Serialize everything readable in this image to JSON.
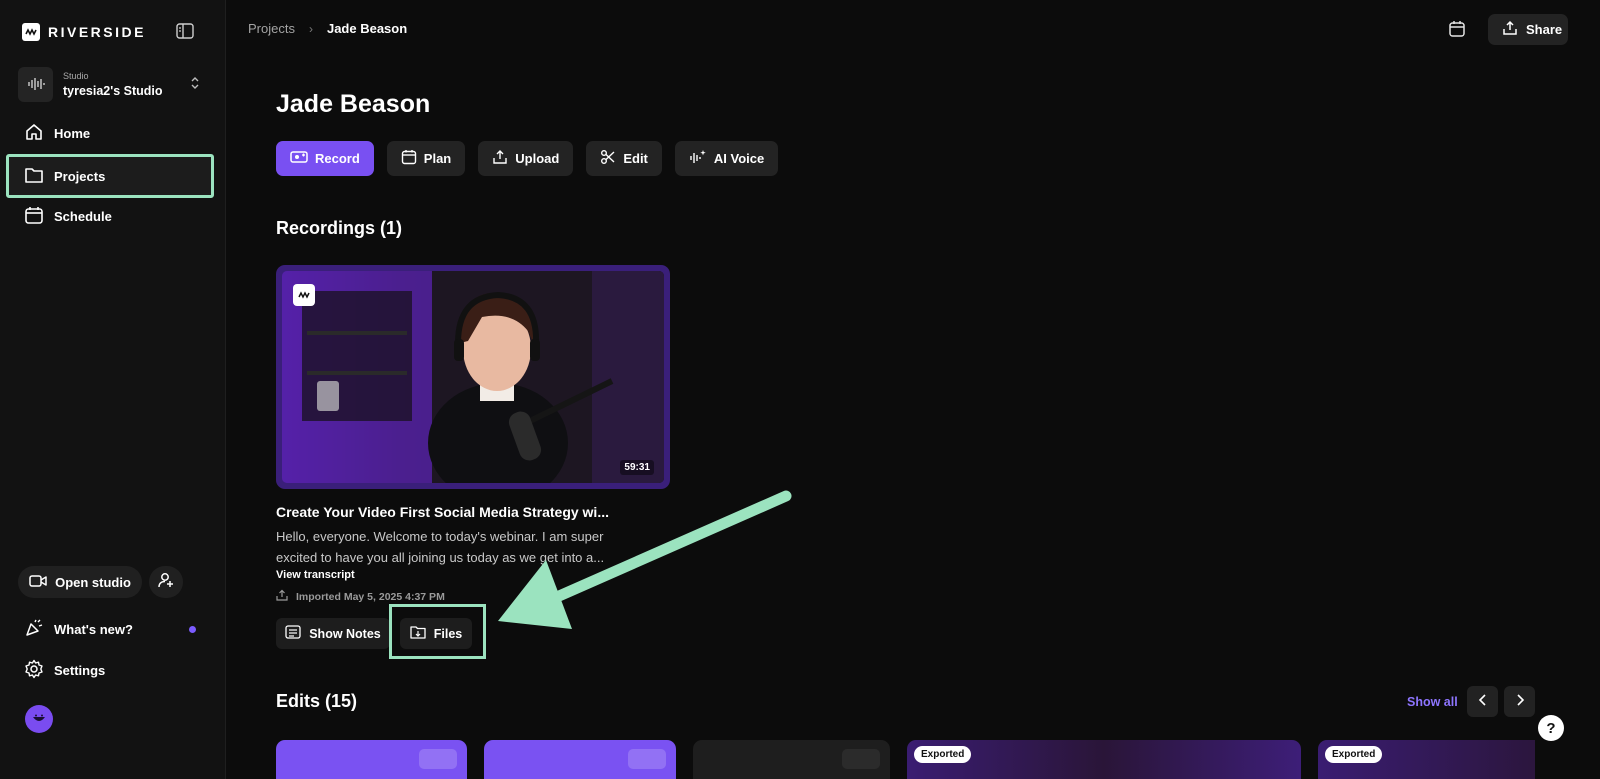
{
  "brand": {
    "name": "RIVERSIDE"
  },
  "studio": {
    "caption": "Studio",
    "name": "tyresia2's Studio"
  },
  "nav": {
    "home": "Home",
    "projects": "Projects",
    "schedule": "Schedule"
  },
  "sidebar_bottom": {
    "open_studio": "Open studio",
    "whats_new": "What's new?",
    "settings": "Settings"
  },
  "breadcrumb": {
    "parent": "Projects",
    "current": "Jade Beason"
  },
  "topbar": {
    "share": "Share"
  },
  "page": {
    "title": "Jade Beason"
  },
  "actions": {
    "record": "Record",
    "plan": "Plan",
    "upload": "Upload",
    "edit": "Edit",
    "ai_voice": "AI Voice"
  },
  "recordings": {
    "heading": "Recordings (1)",
    "item": {
      "duration": "59:31",
      "title": "Create Your Video First Social Media Strategy wi...",
      "snippet": "Hello, everyone. Welcome to today's webinar. I am super excited to have you all joining us today as we get into a...",
      "view_transcript": "View transcript",
      "imported": "Imported May 5, 2025 4:37 PM",
      "show_notes": "Show Notes",
      "files": "Files"
    }
  },
  "edits": {
    "heading": "Edits (15)",
    "show_all": "Show all",
    "exported_label": "Exported"
  },
  "help": {
    "label": "?"
  },
  "colors": {
    "accent": "#7950f2",
    "highlight": "#9be3bf",
    "link": "#8e75ff",
    "background": "#0c0c0c"
  }
}
